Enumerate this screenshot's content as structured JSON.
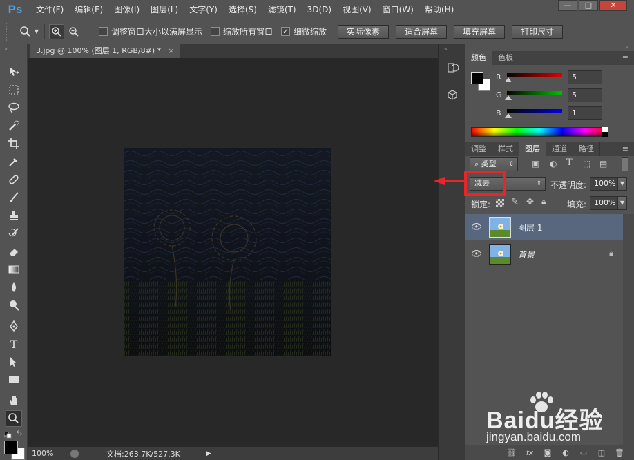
{
  "app": {
    "logo": "Ps"
  },
  "menu": [
    "文件(F)",
    "编辑(E)",
    "图像(I)",
    "图层(L)",
    "文字(Y)",
    "选择(S)",
    "滤镜(T)",
    "3D(D)",
    "视图(V)",
    "窗口(W)",
    "帮助(H)"
  ],
  "window_controls": {
    "minimize": "—",
    "maximize": "□",
    "close": "✕"
  },
  "options": {
    "checkbox_resize": {
      "label": "调整窗口大小以满屏显示",
      "checked": false
    },
    "checkbox_zoom_all": {
      "label": "缩放所有窗口",
      "checked": false
    },
    "checkbox_scrubby": {
      "label": "细微缩放",
      "checked": true
    },
    "btn_actual": "实际像素",
    "btn_fit": "适合屏幕",
    "btn_fill": "填充屏幕",
    "btn_print": "打印尺寸"
  },
  "document": {
    "tab_title": "3.jpg @ 100% (图层 1, RGB/8#) *",
    "close": "×"
  },
  "status": {
    "zoom": "100%",
    "doc_info": "文档:263.7K/527.3K"
  },
  "color_panel": {
    "tabs": [
      "颜色",
      "色板"
    ],
    "active_tab": 0,
    "foreground": "#000000",
    "background": "#ffffff",
    "channels": [
      {
        "label": "R",
        "value": "5",
        "fraction": 0.02,
        "color": "#e00000"
      },
      {
        "label": "G",
        "value": "5",
        "fraction": 0.02,
        "color": "#00c000"
      },
      {
        "label": "B",
        "value": "1",
        "fraction": 0.0,
        "color": "#0000e0"
      }
    ]
  },
  "layers_panel": {
    "tabs": [
      "调整",
      "样式",
      "图层",
      "通道",
      "路径"
    ],
    "active_tab": 2,
    "filter_kind": "类型",
    "blend_mode": "减去",
    "opacity_label": "不透明度:",
    "opacity_value": "100%",
    "lock_label": "锁定:",
    "fill_label": "填充:",
    "fill_value": "100%",
    "layers": [
      {
        "name": "图层 1",
        "selected": true,
        "locked": false,
        "italic": false
      },
      {
        "name": "背景",
        "selected": false,
        "locked": true,
        "italic": true
      }
    ]
  },
  "watermark": {
    "brand": "Baidu经验",
    "url": "jingyan.baidu.com"
  }
}
